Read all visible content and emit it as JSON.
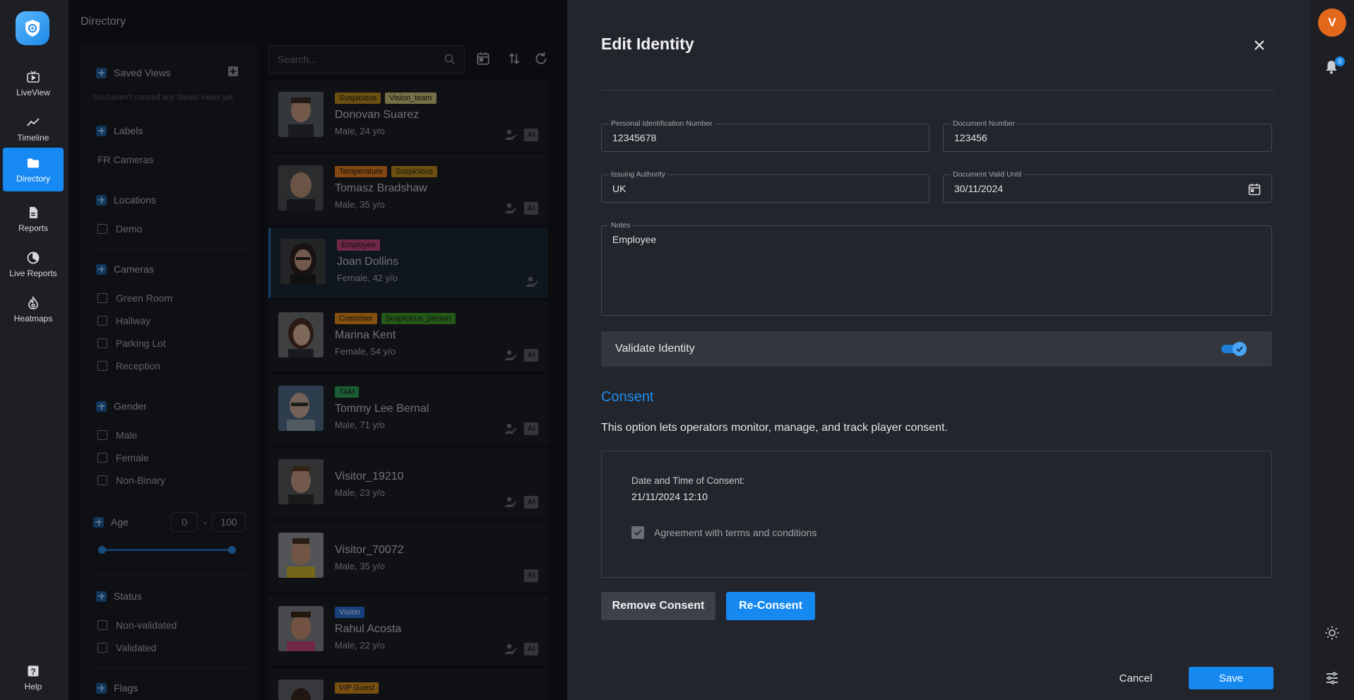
{
  "nav": {
    "items": [
      {
        "label": "LiveView",
        "icon": "tv-play-icon"
      },
      {
        "label": "Timeline",
        "icon": "trend-line-icon"
      },
      {
        "label": "Directory",
        "icon": "folder-icon"
      },
      {
        "label": "Reports",
        "icon": "document-icon"
      },
      {
        "label": "Live Reports",
        "icon": "gauge-icon"
      },
      {
        "label": "Heatmaps",
        "icon": "flame-icon"
      }
    ],
    "help": "Help"
  },
  "directory": {
    "title": "Directory",
    "search_placeholder": "Search...",
    "filters": {
      "saved_views": "Saved Views",
      "saved_views_empty": "You haven't created any Saved views yet",
      "labels": "Labels",
      "labels_item": "FR Cameras",
      "locations": "Locations",
      "locations_items": [
        "Demo"
      ],
      "cameras": "Cameras",
      "cameras_items": [
        "Green Room",
        "Hallway",
        "Parking Lot",
        "Reception"
      ],
      "gender": "Gender",
      "gender_items": [
        "Male",
        "Female",
        "Non-Binary"
      ],
      "age": "Age",
      "age_min": "0",
      "age_max": "100",
      "age_sep": "-",
      "status": "Status",
      "status_items": [
        "Non-validated",
        "Validated"
      ],
      "flags": "Flags"
    },
    "cards": [
      {
        "name": "Donovan Suarez",
        "info": "Male, 24 y/o",
        "tags": [
          {
            "text": "Suspicious",
            "color": "#b88a1e"
          },
          {
            "text": "Vision_team",
            "color": "#c9c07a"
          }
        ]
      },
      {
        "name": "Tomasz Bradshaw",
        "info": "Male, 35 y/o",
        "tags": [
          {
            "text": "Temperature",
            "color": "#e07b1f"
          },
          {
            "text": "Suspicious",
            "color": "#b88a1e"
          }
        ]
      },
      {
        "name": "Joan Dollins",
        "info": "Female, 42 y/o",
        "tags": [
          {
            "text": "Employee",
            "color": "#c0457d"
          }
        ]
      },
      {
        "name": "Marina Kent",
        "info": "Female, 54 y/o",
        "tags": [
          {
            "text": "Customer",
            "color": "#e08a1c"
          },
          {
            "text": "Suspicious_person",
            "color": "#3e9a2b"
          }
        ]
      },
      {
        "name": "Tommy Lee Bernal",
        "info": "Male, 71 y/o",
        "tags": [
          {
            "text": "TAM",
            "color": "#2fa05a"
          }
        ]
      },
      {
        "name": "Visitor_19210",
        "info": "Male, 23 y/o",
        "tags": []
      },
      {
        "name": "Visitor_70072",
        "info": "Male, 35 y/o",
        "tags": []
      },
      {
        "name": "Rahul Acosta",
        "info": "Male, 22 y/o",
        "tags": [
          {
            "text": "Vision",
            "color": "#2a6fd6"
          }
        ]
      },
      {
        "name": "",
        "info": "",
        "tags": [
          {
            "text": "VIP Guest",
            "color": "#d08a1e"
          }
        ]
      }
    ],
    "ai_badge": "AI"
  },
  "modal": {
    "title": "Edit Identity",
    "fields": {
      "pin_label": "Personal Identification Number",
      "pin_value": "12345678",
      "doc_label": "Document Number",
      "doc_value": "123456",
      "authority_label": "Issuing Authority",
      "authority_value": "UK",
      "valid_label": "Document Valid Until",
      "valid_value": "30/11/2024",
      "notes_label": "Notes",
      "notes_value": "Employee"
    },
    "validate_label": "Validate Identity",
    "validate_on": true,
    "consent": {
      "title": "Consent",
      "description": "This option lets operators monitor, manage, and track player consent.",
      "date_label": "Date and Time of Consent:",
      "date_value": "21/11/2024 12:10",
      "agreement": "Agreement with terms and conditions"
    },
    "buttons": {
      "remove": "Remove Consent",
      "reconsent": "Re-Consent",
      "cancel": "Cancel",
      "save": "Save"
    }
  },
  "rail": {
    "avatar_initial": "V",
    "notifications": "0"
  },
  "colors": {
    "accent": "#1589f0",
    "avatar": "#e2681c"
  }
}
